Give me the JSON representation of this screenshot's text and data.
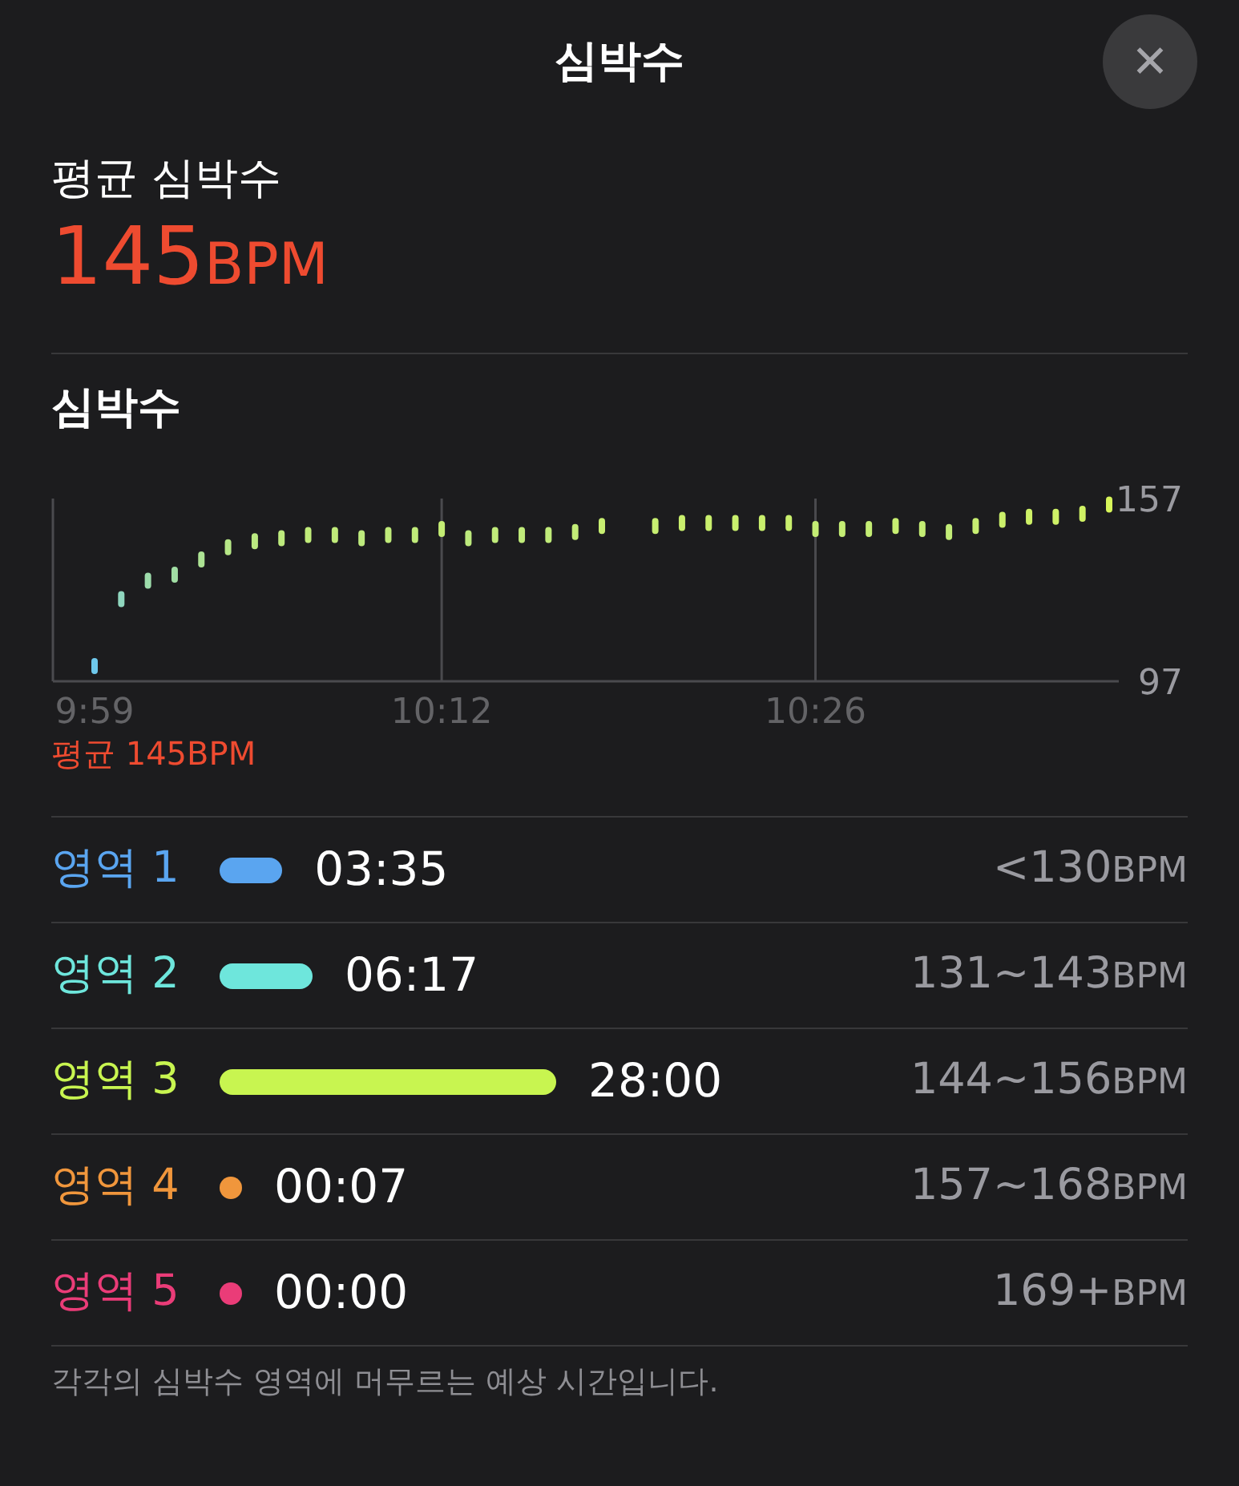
{
  "header": {
    "title": "심박수",
    "close": "✕"
  },
  "average": {
    "label": "평균 심박수",
    "value": "145",
    "unit": "BPM"
  },
  "chart_section": {
    "title": "심박수",
    "chart_data": {
      "type": "scatter",
      "ylim": [
        97,
        157
      ],
      "yticks": [
        157,
        97
      ],
      "categories": [
        "9:59",
        null,
        null,
        null,
        null,
        null,
        null,
        null,
        null,
        null,
        null,
        null,
        null,
        "10:12",
        null,
        null,
        null,
        null,
        null,
        null,
        null,
        null,
        null,
        null,
        null,
        null,
        null,
        "10:26",
        null,
        null,
        null,
        null,
        null,
        null,
        null,
        null,
        null,
        null,
        null
      ],
      "series": [
        {
          "values": [
            102,
            124,
            130,
            132,
            137,
            141,
            143,
            144,
            145,
            145,
            144,
            145,
            145,
            147,
            144,
            145,
            145,
            145,
            146,
            148,
            null,
            148,
            149,
            149,
            149,
            149,
            149,
            147,
            147,
            147,
            148,
            147,
            146,
            148,
            150,
            151,
            151,
            152,
            155
          ]
        }
      ]
    },
    "average_note": "평균 145BPM"
  },
  "zones": [
    {
      "name": "영역 1",
      "color": "#5aa5f0",
      "time": "03:35",
      "range": "<130",
      "unit": "BPM"
    },
    {
      "name": "영역 2",
      "color": "#6ee6dc",
      "time": "06:17",
      "range": "131~143",
      "unit": "BPM"
    },
    {
      "name": "영역 3",
      "color": "#c8f550",
      "time": "28:00",
      "range": "144~156",
      "unit": "BPM"
    },
    {
      "name": "영역 4",
      "color": "#f0963c",
      "time": "00:07",
      "range": "157~168",
      "unit": "BPM"
    },
    {
      "name": "영역 5",
      "color": "#ea3c78",
      "time": "00:00",
      "range": "169+",
      "unit": "BPM"
    }
  ],
  "footnote": "각각의 심박수 영역에 머무르는 예상 시간입니다."
}
